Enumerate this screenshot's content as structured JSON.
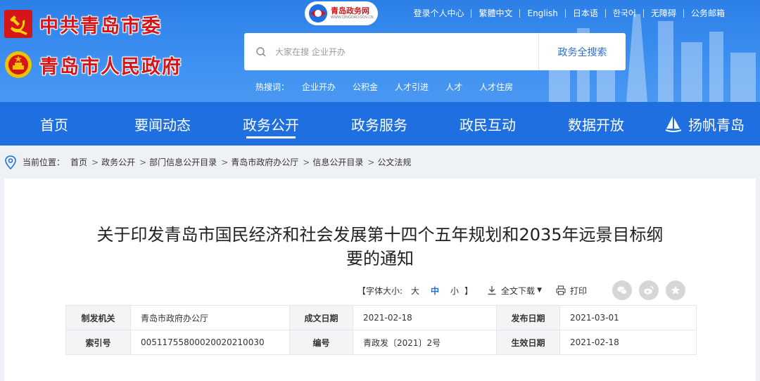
{
  "header": {
    "party_name": "中共青岛市委",
    "gov_name": "青岛市人民政府",
    "portal_logo": "青岛政务网",
    "portal_logo_sub": "WWW.QINGDAO.GOV.CN",
    "top_links": [
      "登录个人中心",
      "繁體中文",
      "English",
      "日本语",
      "한국어",
      "无障碍",
      "公务邮箱"
    ],
    "search": {
      "placeholder": "大家在搜 企业开办",
      "button": "政务全搜索"
    },
    "hot": {
      "label": "热搜词：",
      "keywords": [
        "企业开办",
        "公积金",
        "人才引进",
        "人才",
        "人才住房"
      ]
    }
  },
  "nav": {
    "items": [
      "首页",
      "要闻动态",
      "政务公开",
      "政务服务",
      "政民互动",
      "数据开放",
      "扬帆青岛"
    ],
    "active_index": 2
  },
  "breadcrumb": {
    "label": "当前位置：",
    "items": [
      "首页",
      "政务公开",
      "部门信息公开目录",
      "青岛市政府办公厅",
      "信息公开目录",
      "公文法规"
    ]
  },
  "article": {
    "title_line1": "关于印发青岛市国民经济和社会发展第十四个五年规划和2035年远景目标纲",
    "title_line2": "要的通知",
    "tools": {
      "bracket_open": "【",
      "font_label": "字体大小:",
      "sizes": [
        "大",
        "中",
        "小"
      ],
      "bracket_close": "】",
      "current_size": "中",
      "download": "全文下载",
      "print": "打印"
    },
    "meta": [
      [
        {
          "k": "制发机关",
          "v": "青岛市政府办公厅"
        },
        {
          "k": "成文日期",
          "v": "2021-02-18"
        },
        {
          "k": "发布日期",
          "v": "2021-03-01"
        }
      ],
      [
        {
          "k": "索引号",
          "v": "00511755800020020210030"
        },
        {
          "k": "编号",
          "v": "青政发〔2021〕2号"
        },
        {
          "k": "生效日期",
          "v": "2021-02-18"
        }
      ]
    ]
  },
  "colors": {
    "header_blue": "#3c8ff0",
    "nav_blue": "#1f6fe0",
    "brand_red": "#d4161b"
  }
}
